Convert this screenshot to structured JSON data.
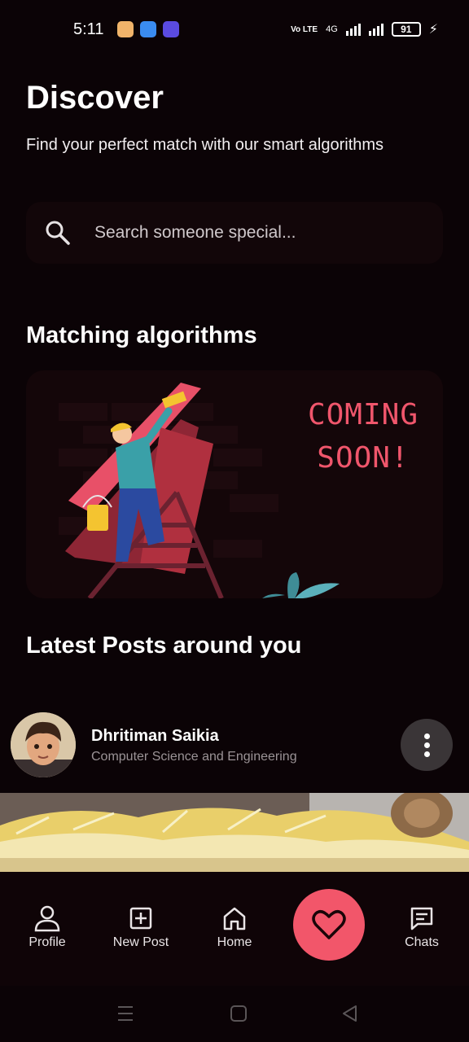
{
  "status_bar": {
    "time": "5:11",
    "volte": "Vo LTE",
    "network": "4G",
    "battery": "91"
  },
  "header": {
    "title": "Discover",
    "subtitle": "Find your perfect match with our smart algorithms"
  },
  "search": {
    "placeholder": "Search someone special..."
  },
  "sections": {
    "matching_title": "Matching algorithms",
    "latest_title": "Latest Posts around you"
  },
  "banner": {
    "line1": "COMING",
    "line2": "SOON!"
  },
  "post": {
    "author": "Dhritiman Saikia",
    "department": "Computer Science and Engineering"
  },
  "bottom_nav": {
    "items": [
      {
        "label": "Profile",
        "icon": "person-icon"
      },
      {
        "label": "New Post",
        "icon": "plus-square-icon"
      },
      {
        "label": "Home",
        "icon": "home-icon"
      },
      {
        "label": "",
        "icon": "heart-icon"
      },
      {
        "label": "Chats",
        "icon": "chat-icon"
      }
    ]
  },
  "colors": {
    "background": "#0b0306",
    "accent": "#f2566a",
    "card": "#140609"
  }
}
